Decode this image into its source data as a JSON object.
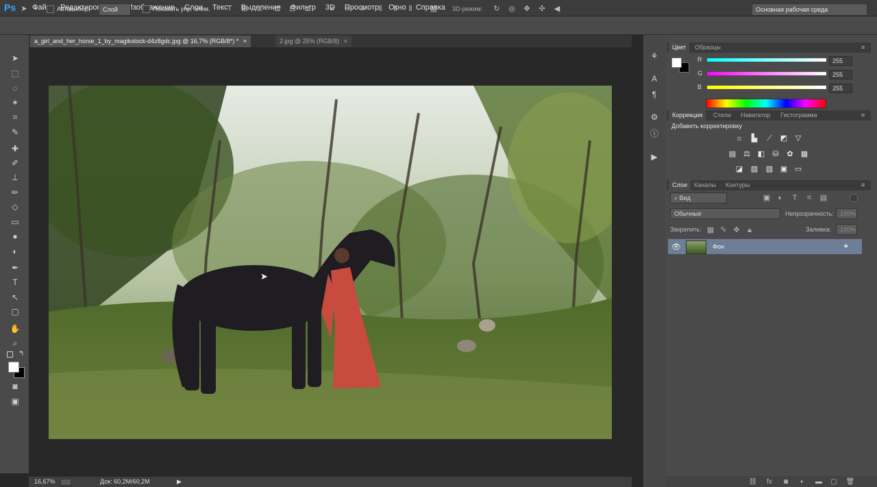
{
  "app": {
    "logo": "Ps"
  },
  "menu": [
    "Файл",
    "Редактирование",
    "Изображение",
    "Слои",
    "Текст",
    "Выделение",
    "Фильтр",
    "3D",
    "Просмотр",
    "Окно",
    "Справка"
  ],
  "options": {
    "autoselect_label": "Автовыбор:",
    "autoselect_value": "Слой",
    "show_controls_label": "Показать упр. элем.",
    "mode_3d_label": "3D-режим:",
    "workspace": "Основная рабочая среда"
  },
  "tabs": [
    {
      "label": "a_girl_and_her_horse_1_by_magikstock-d4z8gdc.jpg @ 16,7% (RGB/8*) *",
      "close": "×"
    },
    {
      "label": "2.jpg @ 25% (RGB/8)",
      "close": "×"
    }
  ],
  "status": {
    "zoom": "16,67%",
    "doc": "Док: 60,2M/60,2M"
  },
  "color_panel": {
    "tabs": [
      "Цвет",
      "Образцы"
    ],
    "channels": [
      {
        "label": "R",
        "value": "255"
      },
      {
        "label": "G",
        "value": "255"
      },
      {
        "label": "B",
        "value": "255"
      }
    ]
  },
  "adjust_panel": {
    "tabs": [
      "Коррекция",
      "Стили",
      "Навигатор",
      "Гистограмма"
    ],
    "title": "Добавить корректировку"
  },
  "layers_panel": {
    "tabs": [
      "Слои",
      "Каналы",
      "Контуры"
    ],
    "filter": "Вид",
    "blend_mode": "Обычные",
    "opacity_label": "Непрозрачность:",
    "opacity_value": "100%",
    "lock_label": "Закрепить:",
    "fill_label": "Заливка:",
    "fill_value": "100%",
    "layers": [
      {
        "name": "Фон"
      }
    ]
  },
  "colors": {
    "layer_selected": "#6d7e96",
    "accent": "#31a8ff"
  }
}
